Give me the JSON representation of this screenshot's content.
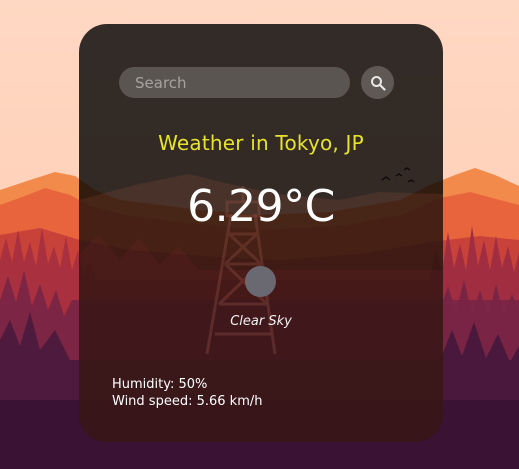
{
  "search": {
    "placeholder": "Search",
    "icon": "magnifier-icon"
  },
  "weather": {
    "title": "Weather in Tokyo, JP",
    "temperature": "6.29°C",
    "condition_icon": "weather-condition-icon",
    "description": "Clear Sky",
    "humidity": "Humidity: 50%",
    "wind_speed": "Wind speed: 5.66 km/h"
  },
  "colors": {
    "title": "#e6e32a",
    "sky": "#ffd9c4",
    "card_overlay": "rgba(0,0,0,0.8)"
  }
}
